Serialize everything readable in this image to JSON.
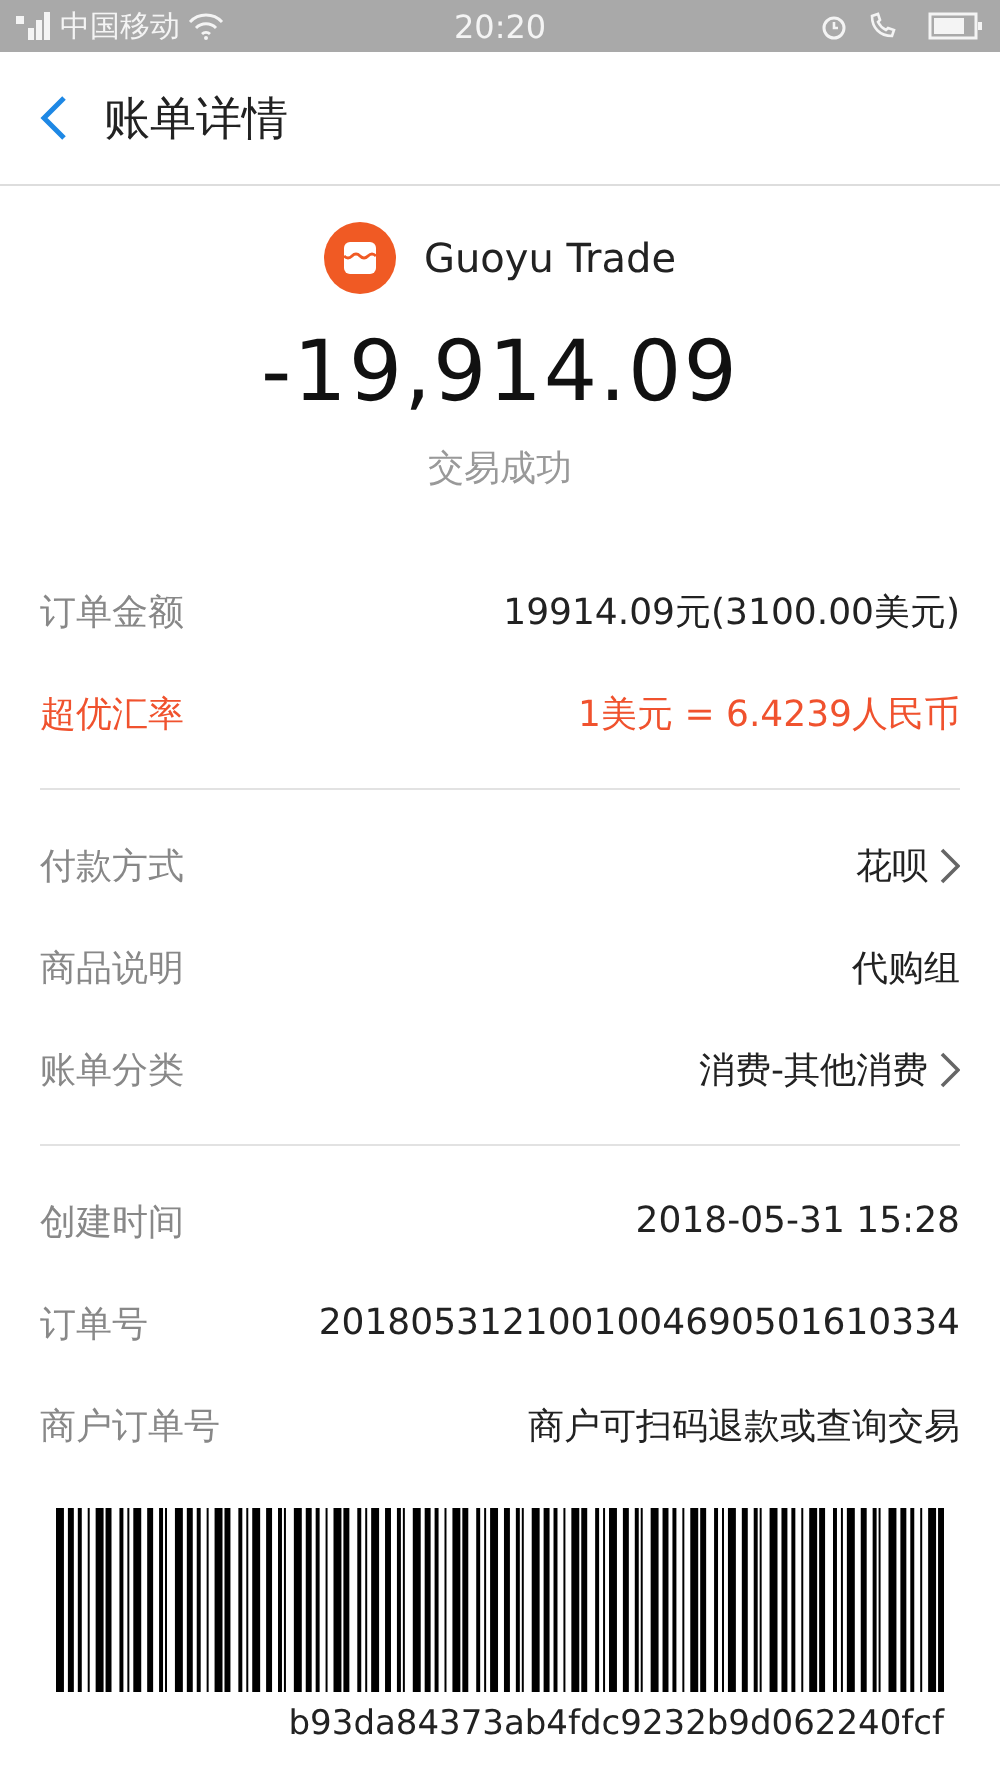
{
  "status_bar": {
    "carrier": "中国移动",
    "time": "20:20"
  },
  "header": {
    "title": "账单详情"
  },
  "summary": {
    "merchant": "Guoyu Trade",
    "amount": "-19,914.09",
    "status": "交易成功"
  },
  "sections": [
    {
      "rows": [
        {
          "kind": "normal",
          "label": "订单金额",
          "value": "19914.09元(3100.00美元)"
        },
        {
          "kind": "highlight",
          "label": "超优汇率",
          "value": "1美元 = 6.4239人民币"
        }
      ]
    },
    {
      "rows": [
        {
          "kind": "normal",
          "label": "付款方式",
          "value": "花呗",
          "link": true
        },
        {
          "kind": "normal",
          "label": "商品说明",
          "value": "代购组"
        },
        {
          "kind": "normal",
          "label": "账单分类",
          "value": "消费-其他消费",
          "link": true
        }
      ]
    },
    {
      "rows": [
        {
          "kind": "normal",
          "label": "创建时间",
          "value": "2018-05-31 15:28"
        },
        {
          "kind": "normal",
          "label": "订单号",
          "value": "2018053121001004690501610334"
        },
        {
          "kind": "normal",
          "label": "商户订单号",
          "value": "商户可扫码退款或查询交易"
        }
      ]
    }
  ],
  "barcode": {
    "code": "b93da84373ab4fdc9232b9d062240fcf"
  }
}
